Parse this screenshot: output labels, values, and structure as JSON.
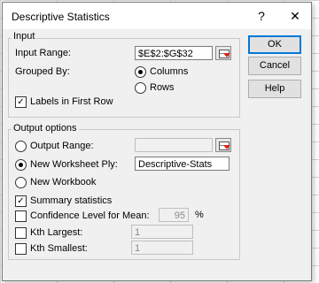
{
  "window": {
    "title": "Descriptive Statistics",
    "help_glyph": "?",
    "close_glyph": "✕"
  },
  "input_group": {
    "label": "Input",
    "input_range_label": "Input Range:",
    "input_range_value": "$E$2:$G$32",
    "grouped_by_label": "Grouped By:",
    "columns_label": "Columns",
    "rows_label": "Rows",
    "grouped_by_selected": "Columns",
    "labels_first_row_label": "Labels in First Row",
    "labels_first_row_checked": true
  },
  "output_group": {
    "label": "Output options",
    "output_range_label": "Output Range:",
    "output_range_value": "",
    "new_ply_label": "New Worksheet Ply:",
    "new_ply_value": "Descriptive-Stats",
    "new_workbook_label": "New Workbook",
    "selected": "New Worksheet Ply:",
    "summary_label": "Summary statistics",
    "summary_checked": true,
    "confidence_label": "Confidence Level for Mean:",
    "confidence_value": "95",
    "confidence_unit": "%",
    "confidence_checked": false,
    "kth_largest_label": "Kth Largest:",
    "kth_largest_value": "1",
    "kth_largest_checked": false,
    "kth_smallest_label": "Kth Smallest:",
    "kth_smallest_value": "1",
    "kth_smallest_checked": false
  },
  "buttons": {
    "ok": "OK",
    "cancel": "Cancel",
    "help": "Help"
  },
  "icons": {
    "check_glyph": "✓",
    "ref_icon": "range-select-icon"
  }
}
